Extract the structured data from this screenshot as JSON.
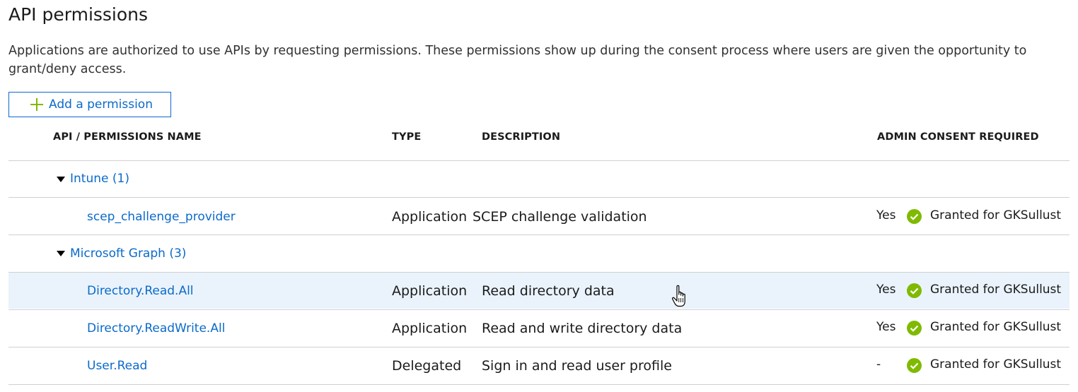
{
  "page": {
    "title": "API permissions",
    "description": "Applications are authorized to use APIs by requesting permissions. These permissions show up during the consent process where users are given the opportunity to grant/deny access."
  },
  "toolbar": {
    "add_permission_label": "Add a permission",
    "add_icon": "plus-icon"
  },
  "table": {
    "headers": {
      "name": "API / PERMISSIONS NAME",
      "type": "TYPE",
      "description": "DESCRIPTION",
      "admin_consent": "ADMIN CONSENT REQUIRED"
    },
    "groups": [
      {
        "label": "Intune (1)",
        "expanded": true,
        "rows": [
          {
            "name": "scep_challenge_provider",
            "type": "Application",
            "description": "SCEP challenge validation",
            "admin_consent": "Yes",
            "status": "Granted for GKSullust"
          }
        ]
      },
      {
        "label": "Microsoft Graph (3)",
        "expanded": true,
        "rows": [
          {
            "name": "Directory.Read.All",
            "type": "Application",
            "description": "Read directory data",
            "admin_consent": "Yes",
            "status": "Granted for GKSullust",
            "hovered": true
          },
          {
            "name": "Directory.ReadWrite.All",
            "type": "Application",
            "description": "Read and write directory data",
            "admin_consent": "Yes",
            "status": "Granted for GKSullust"
          },
          {
            "name": "User.Read",
            "type": "Delegated",
            "description": "Sign in and read user profile",
            "admin_consent": "-",
            "status": "Granted for GKSullust"
          }
        ]
      }
    ]
  },
  "colors": {
    "link": "#0b6acb",
    "granted_check": "#7fba00",
    "hover_row": "#eaf3fb",
    "add_icon": "#7fba00"
  }
}
